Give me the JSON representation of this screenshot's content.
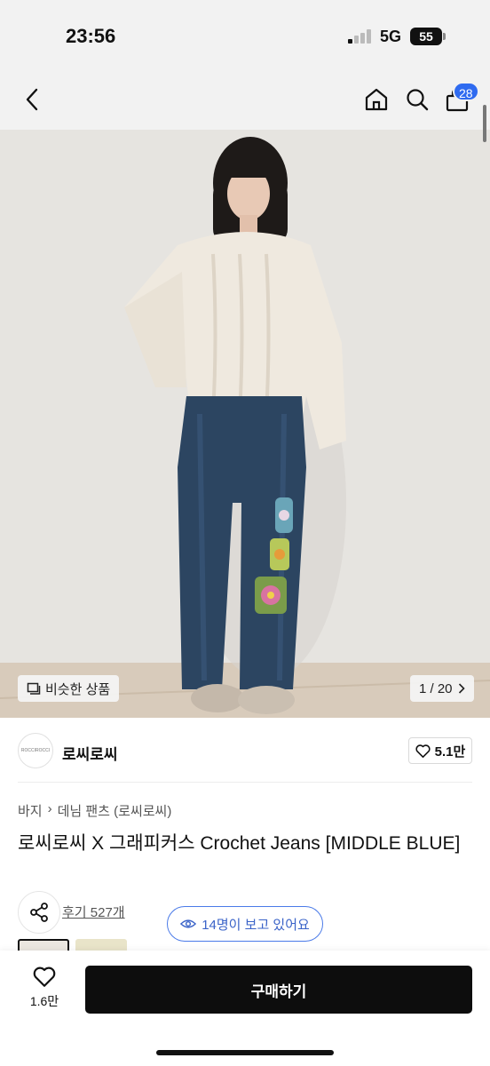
{
  "status_bar": {
    "time": "23:56",
    "network": "5G",
    "battery": "55"
  },
  "header": {
    "back_icon": "chevron-left-icon",
    "home_icon": "home-icon",
    "search_icon": "search-icon",
    "cart_icon": "shopping-bag-icon",
    "cart_count": "28"
  },
  "gallery": {
    "similar_label": "비슷한 상품",
    "page_indicator": "1 / 20"
  },
  "brand": {
    "logo_text": "ROCCIROCCI",
    "name": "로씨로씨",
    "likes": "5.1만"
  },
  "product": {
    "breadcrumb": [
      "바지",
      "데님 팬츠 (로씨로씨)"
    ],
    "title": "로씨로씨 X 그래피커스 Crochet Jeans [MIDDLE BLUE]",
    "review_link": "후기 527개",
    "viewers": "14명이 보고 있어요"
  },
  "bottom_bar": {
    "like_count": "1.6만",
    "buy_label": "구매하기"
  },
  "colors": {
    "accent_blue": "#2f6bf0",
    "viewers_blue": "#4a7ae8",
    "buy_button": "#0d0d0d"
  }
}
